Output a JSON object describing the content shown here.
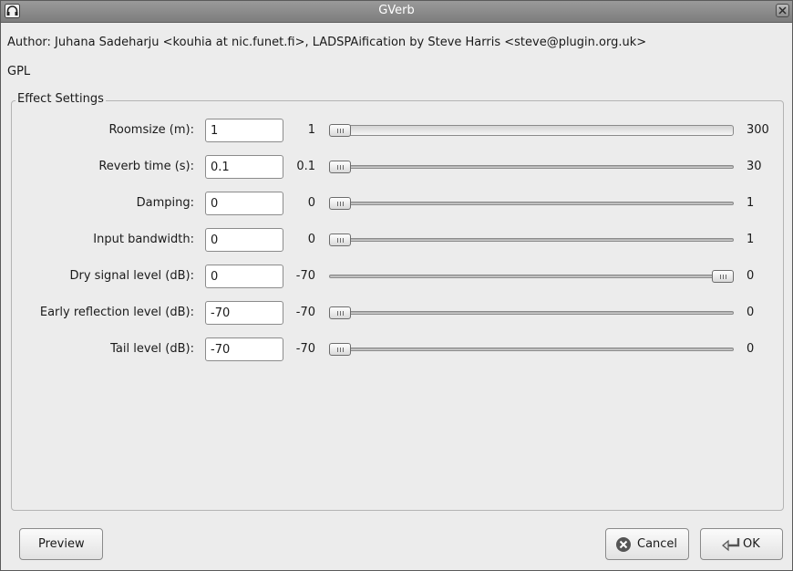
{
  "window": {
    "title": "GVerb"
  },
  "plugin": {
    "author": "Author: Juhana Sadeharju <kouhia at nic.funet.fi>, LADSPAification by Steve Harris <steve@plugin.org.uk>",
    "license": "GPL"
  },
  "effect_settings": {
    "legend": "Effect Settings",
    "controls": [
      {
        "label": "Roomsize (m):",
        "value": "1",
        "min": "1",
        "max": "300",
        "slider_position": 0.0
      },
      {
        "label": "Reverb time (s):",
        "value": "0.1",
        "min": "0.1",
        "max": "30",
        "slider_position": 0.0
      },
      {
        "label": "Damping:",
        "value": "0",
        "min": "0",
        "max": "1",
        "slider_position": 0.0
      },
      {
        "label": "Input bandwidth:",
        "value": "0",
        "min": "0",
        "max": "1",
        "slider_position": 0.0
      },
      {
        "label": "Dry signal level (dB):",
        "value": "0",
        "min": "-70",
        "max": "0",
        "slider_position": 1.0
      },
      {
        "label": "Early reflection level (dB):",
        "value": "-70",
        "min": "-70",
        "max": "0",
        "slider_position": 0.0
      },
      {
        "label": "Tail level (dB):",
        "value": "-70",
        "min": "-70",
        "max": "0",
        "slider_position": 0.0
      }
    ]
  },
  "buttons": {
    "preview": "Preview",
    "cancel": "Cancel",
    "ok": "OK"
  }
}
